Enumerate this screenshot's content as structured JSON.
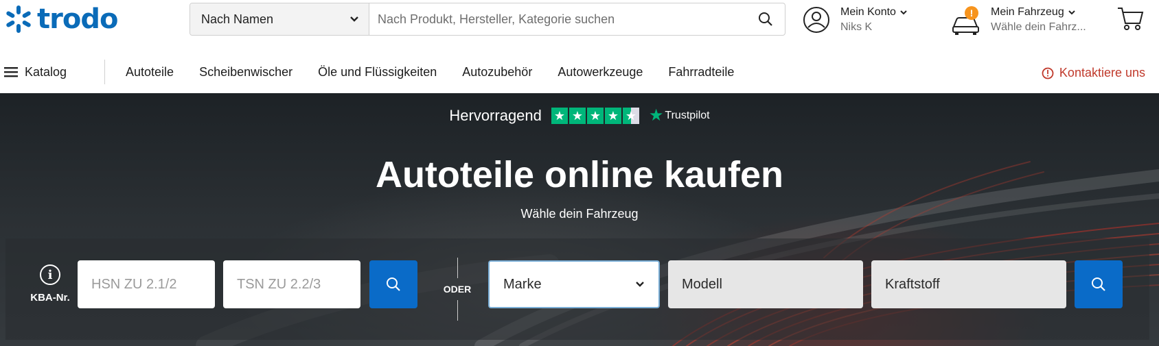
{
  "header": {
    "logo_text": "trodo",
    "search": {
      "select_value": "Nach Namen",
      "placeholder": "Nach Produkt, Hersteller, Kategorie suchen"
    },
    "account": {
      "label": "Mein Konto",
      "user": "Niks K"
    },
    "vehicle": {
      "label": "Mein Fahrzeug",
      "hint": "Wähle dein Fahrz...",
      "badge": "!"
    }
  },
  "nav": {
    "catalog_label": "Katalog",
    "links": [
      "Autoteile",
      "Scheibenwischer",
      "Öle und Flüssigkeiten",
      "Autozubehör",
      "Autowerkzeuge",
      "Fahrradteile"
    ],
    "contact_label": "Kontaktiere uns"
  },
  "hero": {
    "rating_word": "Hervorragend",
    "trustpilot_label": "Trustpilot",
    "rating_stars": 4.5,
    "title": "Autoteile online kaufen",
    "subtitle": "Wähle dein Fahrzeug",
    "kba_label": "KBA-Nr.",
    "hsn_placeholder": "HSN ZU 2.1/2",
    "tsn_placeholder": "TSN ZU 2.2/3",
    "or_label": "ODER",
    "brand_select": "Marke",
    "model_field": "Modell",
    "fuel_field": "Kraftstoff"
  },
  "colors": {
    "brand_blue": "#0a6bb8",
    "button_blue": "#0a6bc8",
    "contact_red": "#c0392b",
    "trustpilot_green": "#00b67a",
    "badge_orange": "#f7941d"
  }
}
